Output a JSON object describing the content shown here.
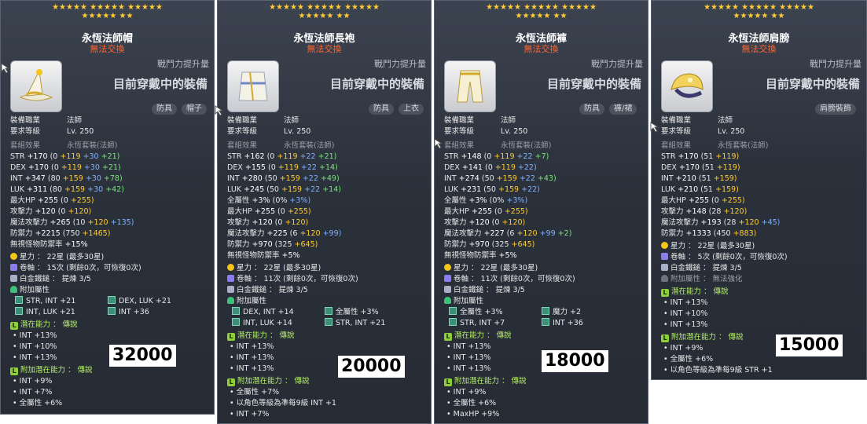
{
  "colors": {
    "star": "#ffcc33",
    "trade_warning": "#ff6633",
    "potential_tier": "#b5f06a",
    "bonus_yellow": "#ffcc33",
    "bonus_blue": "#7fb2ff",
    "bonus_green": "#7fe27f"
  },
  "panels": [
    {
      "stars_row1": "★★★★★ ★★★★★ ★★★★★",
      "stars_row2": "★★★★★ ★★",
      "title": "永恆法師帽",
      "trade": "無法交換",
      "upgrade_note": "戰鬥力提升量",
      "equipped": "目前穿戴中的裝備",
      "tags": [
        "防具",
        "帽子"
      ],
      "job_label": "裝備職業",
      "job": "法師",
      "level_label": "要求等級",
      "level": "Lv. 250",
      "set_label": "套組效果",
      "set": "永恆套裝(法師)",
      "stats": [
        {
          "name": "STR",
          "total": "+170",
          "base": "(0",
          "y": "+119",
          "b": "+30",
          "g": "+21)"
        },
        {
          "name": "DEX",
          "total": "+170",
          "base": "(0",
          "y": "+119",
          "b": "+30",
          "g": "+21)"
        },
        {
          "name": "INT",
          "total": "+347",
          "base": "(80",
          "y": "+159",
          "b": "+30",
          "g": "+78)"
        },
        {
          "name": "LUK",
          "total": "+311",
          "base": "(80",
          "y": "+159",
          "b": "+30",
          "g": "+42)"
        },
        {
          "name": "最大HP",
          "total": "+255",
          "base": "(0",
          "y": "+255)",
          "b": "",
          "g": ""
        },
        {
          "name": "攻擊力",
          "total": "+120",
          "base": "(0",
          "y": "+120)",
          "b": "",
          "g": ""
        },
        {
          "name": "魔法攻擊力",
          "total": "+265",
          "base": "(10",
          "y": "+120",
          "b": "+135)",
          "g": ""
        },
        {
          "name": "防禦力",
          "total": "+2215",
          "base": "(750",
          "y": "+1465)",
          "b": "",
          "g": ""
        },
        {
          "name": "無視怪物防禦率",
          "total": "+15%",
          "base": "",
          "y": "",
          "b": "",
          "g": ""
        }
      ],
      "starforce": "星力 ： 22星 (最多30星)",
      "scroll": "卷軸 ： 15次 (剩餘0次，可恢復0次)",
      "hammer": "白金鐵鎚 ： 提煉 3/5",
      "flame_label": "附加屬性",
      "flames": [
        "STR, INT  +21",
        "DEX, LUK  +21",
        "INT, LUK  +21",
        "INT  +36"
      ],
      "potential_label": "潛在能力 ： 傳說",
      "potentials": [
        "INT +13%",
        "INT +10%",
        "INT +13%"
      ],
      "bonus_label": "附加潛在能力 ： 傳說",
      "bonus": [
        "INT +9%",
        "INT +7%",
        "全屬性 +6%"
      ],
      "price": "32000"
    },
    {
      "stars_row1": "★★★★★ ★★★★★ ★★★★★",
      "stars_row2": "★★★★★ ★★",
      "title": "永恆法師長袍",
      "trade": "無法交換",
      "upgrade_note": "戰鬥力提升量",
      "equipped": "目前穿戴中的裝備",
      "tags": [
        "防具",
        "上衣"
      ],
      "job_label": "裝備職業",
      "job": "法師",
      "level_label": "要求等級",
      "level": "Lv. 250",
      "set_label": "套組效果",
      "set": "永恆套裝(法師)",
      "stats": [
        {
          "name": "STR",
          "total": "+162",
          "base": "(0",
          "y": "+119",
          "b": "+22",
          "g": "+21)"
        },
        {
          "name": "DEX",
          "total": "+155",
          "base": "(0",
          "y": "+119",
          "b": "+22",
          "g": "+14)"
        },
        {
          "name": "INT",
          "total": "+280",
          "base": "(50",
          "y": "+159",
          "b": "+22",
          "g": "+49)"
        },
        {
          "name": "LUK",
          "total": "+245",
          "base": "(50",
          "y": "+159",
          "b": "+22",
          "g": "+14)"
        },
        {
          "name": "全屬性",
          "total": "+3%",
          "base": "(0%",
          "y": "",
          "b": "+3%)",
          "g": ""
        },
        {
          "name": "最大HP",
          "total": "+255",
          "base": "(0",
          "y": "+255)",
          "b": "",
          "g": ""
        },
        {
          "name": "攻擊力",
          "total": "+120",
          "base": "(0",
          "y": "+120)",
          "b": "",
          "g": ""
        },
        {
          "name": "魔法攻擊力",
          "total": "+225",
          "base": "(6",
          "y": "+120",
          "b": "+99)",
          "g": ""
        },
        {
          "name": "防禦力",
          "total": "+970",
          "base": "(325",
          "y": "+645)",
          "b": "",
          "g": ""
        },
        {
          "name": "無視怪物防禦率",
          "total": "+5%",
          "base": "",
          "y": "",
          "b": "",
          "g": ""
        }
      ],
      "starforce": "星力 ： 22星 (最多30星)",
      "scroll": "卷軸 ： 11次 (剩餘0次，可恢復0次)",
      "hammer": "白金鐵鎚 ： 提煉 3/5",
      "flame_label": "附加屬性",
      "flames": [
        "DEX, INT  +14",
        "全屬性  +3%",
        "INT, LUK  +14",
        "STR, INT  +21"
      ],
      "potential_label": "潛在能力 ： 傳說",
      "potentials": [
        "INT +13%",
        "INT +13%",
        "INT +13%"
      ],
      "bonus_label": "附加潛在能力 ： 傳說",
      "bonus": [
        "全屬性 +7%",
        "以角色等級為準每9級 INT +1",
        "INT +7%"
      ],
      "price": "20000"
    },
    {
      "stars_row1": "★★★★★ ★★★★★ ★★★★★",
      "stars_row2": "★★★★★ ★★",
      "title": "永恆法師褲",
      "trade": "無法交換",
      "upgrade_note": "戰鬥力提升量",
      "equipped": "目前穿戴中的裝備",
      "tags": [
        "防具",
        "褲/裙"
      ],
      "job_label": "裝備職業",
      "job": "法師",
      "level_label": "要求等級",
      "level": "Lv. 250",
      "set_label": "套組效果",
      "set": "永恆套裝(法師)",
      "stats": [
        {
          "name": "STR",
          "total": "+148",
          "base": "(0",
          "y": "+119",
          "b": "+22",
          "g": "+7)"
        },
        {
          "name": "DEX",
          "total": "+141",
          "base": "(0",
          "y": "+119",
          "b": "+22)",
          "g": ""
        },
        {
          "name": "INT",
          "total": "+274",
          "base": "(50",
          "y": "+159",
          "b": "+22",
          "g": "+43)"
        },
        {
          "name": "LUK",
          "total": "+231",
          "base": "(50",
          "y": "+159",
          "b": "+22)",
          "g": ""
        },
        {
          "name": "全屬性",
          "total": "+3%",
          "base": "(0%",
          "y": "",
          "b": "+3%)",
          "g": ""
        },
        {
          "name": "最大HP",
          "total": "+255",
          "base": "(0",
          "y": "+255)",
          "b": "",
          "g": ""
        },
        {
          "name": "攻擊力",
          "total": "+120",
          "base": "(0",
          "y": "+120)",
          "b": "",
          "g": ""
        },
        {
          "name": "魔法攻擊力",
          "total": "+227",
          "base": "(6",
          "y": "+120",
          "b": "+99",
          "g": "+2)"
        },
        {
          "name": "防禦力",
          "total": "+970",
          "base": "(325",
          "y": "+645)",
          "b": "",
          "g": ""
        },
        {
          "name": "無視怪物防禦率",
          "total": "+5%",
          "base": "",
          "y": "",
          "b": "",
          "g": ""
        }
      ],
      "starforce": "星力 ： 22星 (最多30星)",
      "scroll": "卷軸 ： 11次 (剩餘0次，可恢復0次)",
      "hammer": "白金鐵鎚 ： 提煉 3/5",
      "flame_label": "附加屬性",
      "flames": [
        "全屬性  +3%",
        "魔力  +2",
        "STR, INT  +7",
        "INT  +36"
      ],
      "potential_label": "潛在能力 ： 傳說",
      "potentials": [
        "INT +13%",
        "INT +13%",
        "INT +13%"
      ],
      "bonus_label": "附加潛在能力 ： 傳說",
      "bonus": [
        "INT +9%",
        "全屬性 +6%",
        "MaxHP +9%"
      ],
      "price": "18000"
    },
    {
      "stars_row1": "★★★★★ ★★★★★ ★★★★★",
      "stars_row2": "★★★★★ ★★",
      "title": "永恆法師肩膀",
      "trade": "無法交換",
      "upgrade_note": "戰鬥力提升量",
      "equipped": "目前穿戴中的裝備",
      "tags": [
        "肩膀裝飾"
      ],
      "job_label": "裝備職業",
      "job": "法師",
      "level_label": "要求等級",
      "level": "Lv. 250",
      "set_label": "套組效果",
      "set": "永恆套裝(法師)",
      "stats": [
        {
          "name": "STR",
          "total": "+170",
          "base": "(51",
          "y": "+119)",
          "b": "",
          "g": ""
        },
        {
          "name": "DEX",
          "total": "+170",
          "base": "(51",
          "y": "+119)",
          "b": "",
          "g": ""
        },
        {
          "name": "INT",
          "total": "+210",
          "base": "(51",
          "y": "+159)",
          "b": "",
          "g": ""
        },
        {
          "name": "LUK",
          "total": "+210",
          "base": "(51",
          "y": "+159)",
          "b": "",
          "g": ""
        },
        {
          "name": "最大HP",
          "total": "+255",
          "base": "(0",
          "y": "+255)",
          "b": "",
          "g": ""
        },
        {
          "name": "攻擊力",
          "total": "+148",
          "base": "(28",
          "y": "+120)",
          "b": "",
          "g": ""
        },
        {
          "name": "魔法攻擊力",
          "total": "+193",
          "base": "(28",
          "y": "+120",
          "b": "+45)",
          "g": ""
        },
        {
          "name": "防禦力",
          "total": "+1333",
          "base": "(450",
          "y": "+883)",
          "b": "",
          "g": ""
        }
      ],
      "starforce": "星力 ： 22星 (最多30星)",
      "scroll": "卷軸 ： 5次 (剩餘0次，可恢復0次)",
      "hammer": "白金鐵鎚 ： 提煉 3/5",
      "flame_label": "附加屬性 ： 無法強化",
      "flames": [],
      "potential_label": "潛在能力 ： 傳說",
      "potentials": [
        "INT +13%",
        "INT +10%",
        "INT +13%"
      ],
      "bonus_label": "附加潛在能力 ： 傳說",
      "bonus": [
        "INT +9%",
        "全屬性 +6%",
        "以角色等級為準每9級 STR +1"
      ],
      "price": "15000"
    }
  ]
}
